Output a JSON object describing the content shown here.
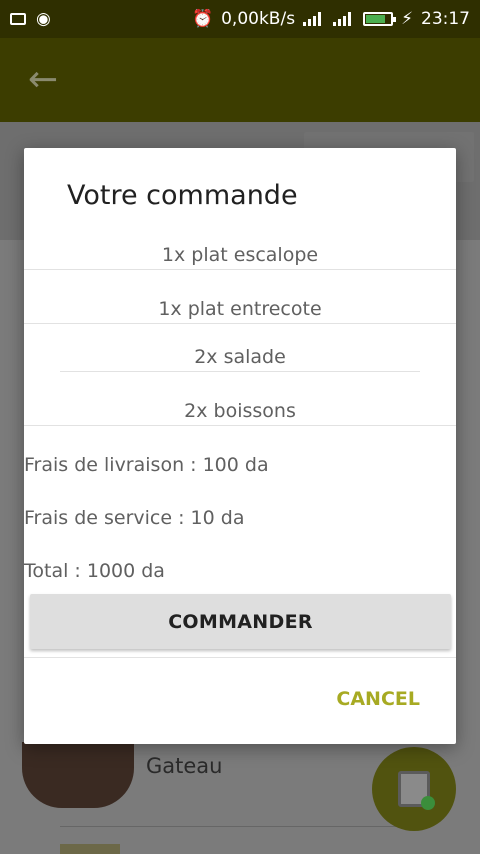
{
  "status_bar": {
    "speed": "0,00kB/s",
    "time": "23:17",
    "battery_level": 0.8
  },
  "dialog": {
    "title": "Votre commande",
    "items": [
      "1x   plat escalope",
      "1x   plat entrecote",
      "2x  salade",
      "2x boissons"
    ],
    "delivery_fee": "Frais de livraison : 100 da",
    "service_fee": "Frais de service : 10 da",
    "total": "Total : 1000 da",
    "order_button": "COMMANDER",
    "cancel_button": "CANCEL"
  },
  "background_list": {
    "item_label": "Gateau"
  },
  "colors": {
    "accent": "#a7aa23",
    "status_bar": "#2f2f00",
    "app_bar": "#3c3d00"
  }
}
